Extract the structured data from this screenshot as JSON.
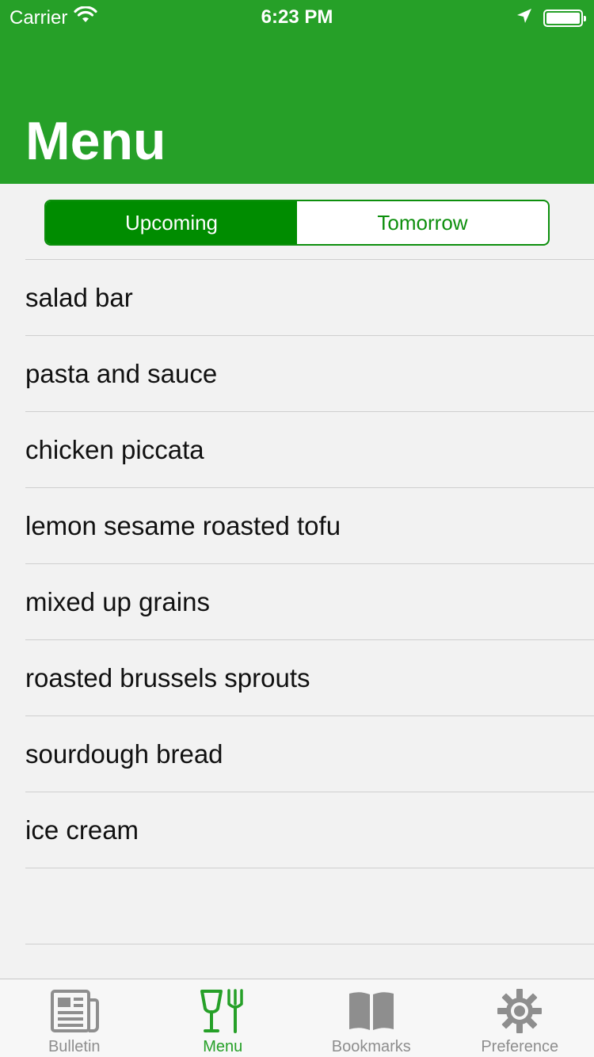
{
  "status_bar": {
    "carrier": "Carrier",
    "time": "6:23 PM"
  },
  "header": {
    "title": "Menu",
    "background_color": "#26a028"
  },
  "segmented_control": {
    "segments": [
      {
        "label": "Upcoming",
        "selected": true
      },
      {
        "label": "Tomorrow",
        "selected": false
      }
    ],
    "accent_color": "#008c00"
  },
  "menu_items": [
    "salad bar",
    "pasta and sauce",
    "chicken piccata",
    "lemon sesame roasted tofu",
    "mixed up grains",
    "roasted brussels sprouts",
    "sourdough bread",
    "ice cream"
  ],
  "tab_bar": {
    "tabs": [
      {
        "label": "Bulletin",
        "icon": "newspaper-icon",
        "active": false
      },
      {
        "label": "Menu",
        "icon": "fork-knife-icon",
        "active": true
      },
      {
        "label": "Bookmarks",
        "icon": "book-icon",
        "active": false
      },
      {
        "label": "Preference",
        "icon": "gear-icon",
        "active": false
      }
    ]
  }
}
